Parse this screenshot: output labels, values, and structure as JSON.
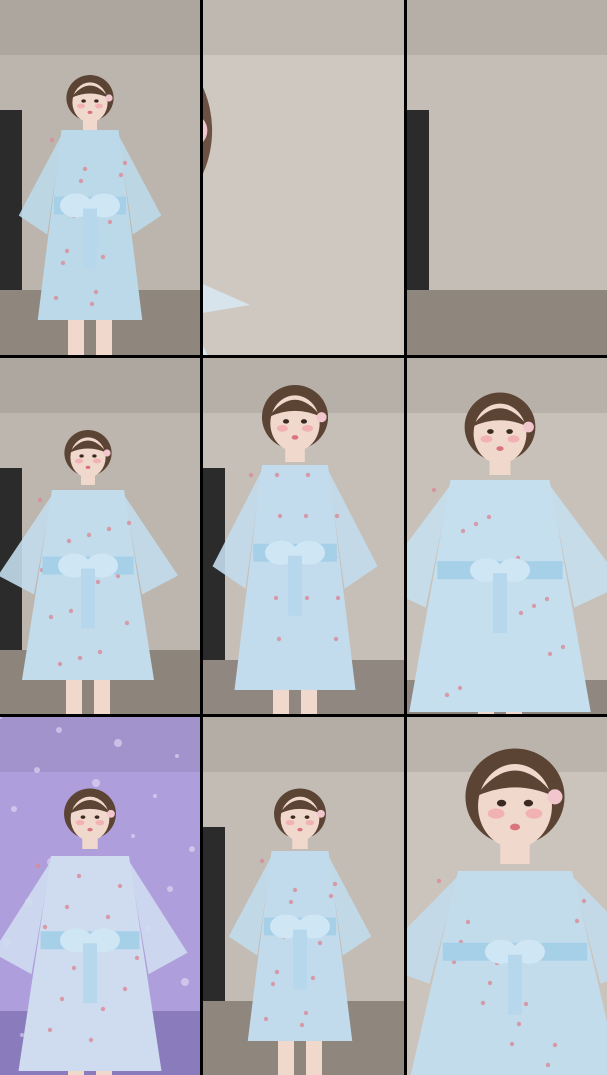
{
  "layout": {
    "columns": 3,
    "rows": 3
  },
  "tiles": [
    {
      "index": 0,
      "description": "full-body",
      "wall": "#bcb5ad",
      "floor": "#8f877e",
      "outfit": "#bcd9ea",
      "sash": "#a6cfe8",
      "accent": "#d98a97",
      "hair": "#5c4434",
      "skin": "#f1d8cc"
    },
    {
      "index": 1,
      "description": "face-close-up",
      "wall": "#cfc8c0",
      "floor": "#cfc8c0",
      "outfit": "#d7e7ef",
      "sash": "#a6cfe8",
      "accent": "#d98a97",
      "hair": "#6b5141",
      "skin": "#f3dcd1"
    },
    {
      "index": 2,
      "description": "full-body",
      "wall": "#c5beb6",
      "floor": "#8f877e",
      "outfit": "#c7dfee",
      "sash": "#a6cfe8",
      "accent": "#d98a97",
      "hair": "#5c4434",
      "skin": "#f1d8cc"
    },
    {
      "index": 3,
      "description": "full-body",
      "wall": "#bdb6ae",
      "floor": "#8d857c",
      "outfit": "#c2dcec",
      "sash": "#a6cfe8",
      "accent": "#d98a97",
      "hair": "#5c4434",
      "skin": "#f1d8cc"
    },
    {
      "index": 4,
      "description": "full-body",
      "wall": "#c6bfb7",
      "floor": "#908880",
      "outfit": "#c3dced",
      "sash": "#a6cfe8",
      "accent": "#d98a97",
      "hair": "#5c4434",
      "skin": "#f1d8cc"
    },
    {
      "index": 5,
      "description": "upper-body",
      "wall": "#c8c1b9",
      "floor": "#908880",
      "outfit": "#c6dfee",
      "sash": "#a6cfe8",
      "accent": "#d98a97",
      "hair": "#5c4434",
      "skin": "#f1d8cc"
    },
    {
      "index": 6,
      "description": "full-body-purple-effect",
      "wall": "#b7a9dc",
      "floor": "#8a7fb5",
      "outfit": "#cfdcef",
      "sash": "#a6cfe8",
      "accent": "#d98a97",
      "hair": "#5c4434",
      "skin": "#f1d8cc"
    },
    {
      "index": 7,
      "description": "full-body",
      "wall": "#c3bcb4",
      "floor": "#8f877e",
      "outfit": "#c1dbec",
      "sash": "#a6cfe8",
      "accent": "#d98a97",
      "hair": "#5c4434",
      "skin": "#f1d8cc"
    },
    {
      "index": 8,
      "description": "upper-body-close",
      "wall": "#cbc4bc",
      "floor": "#cbc4bc",
      "outfit": "#c3dcec",
      "sash": "#a6cfe8",
      "accent": "#d98a97",
      "hair": "#5c4434",
      "skin": "#f1d8cc"
    }
  ]
}
